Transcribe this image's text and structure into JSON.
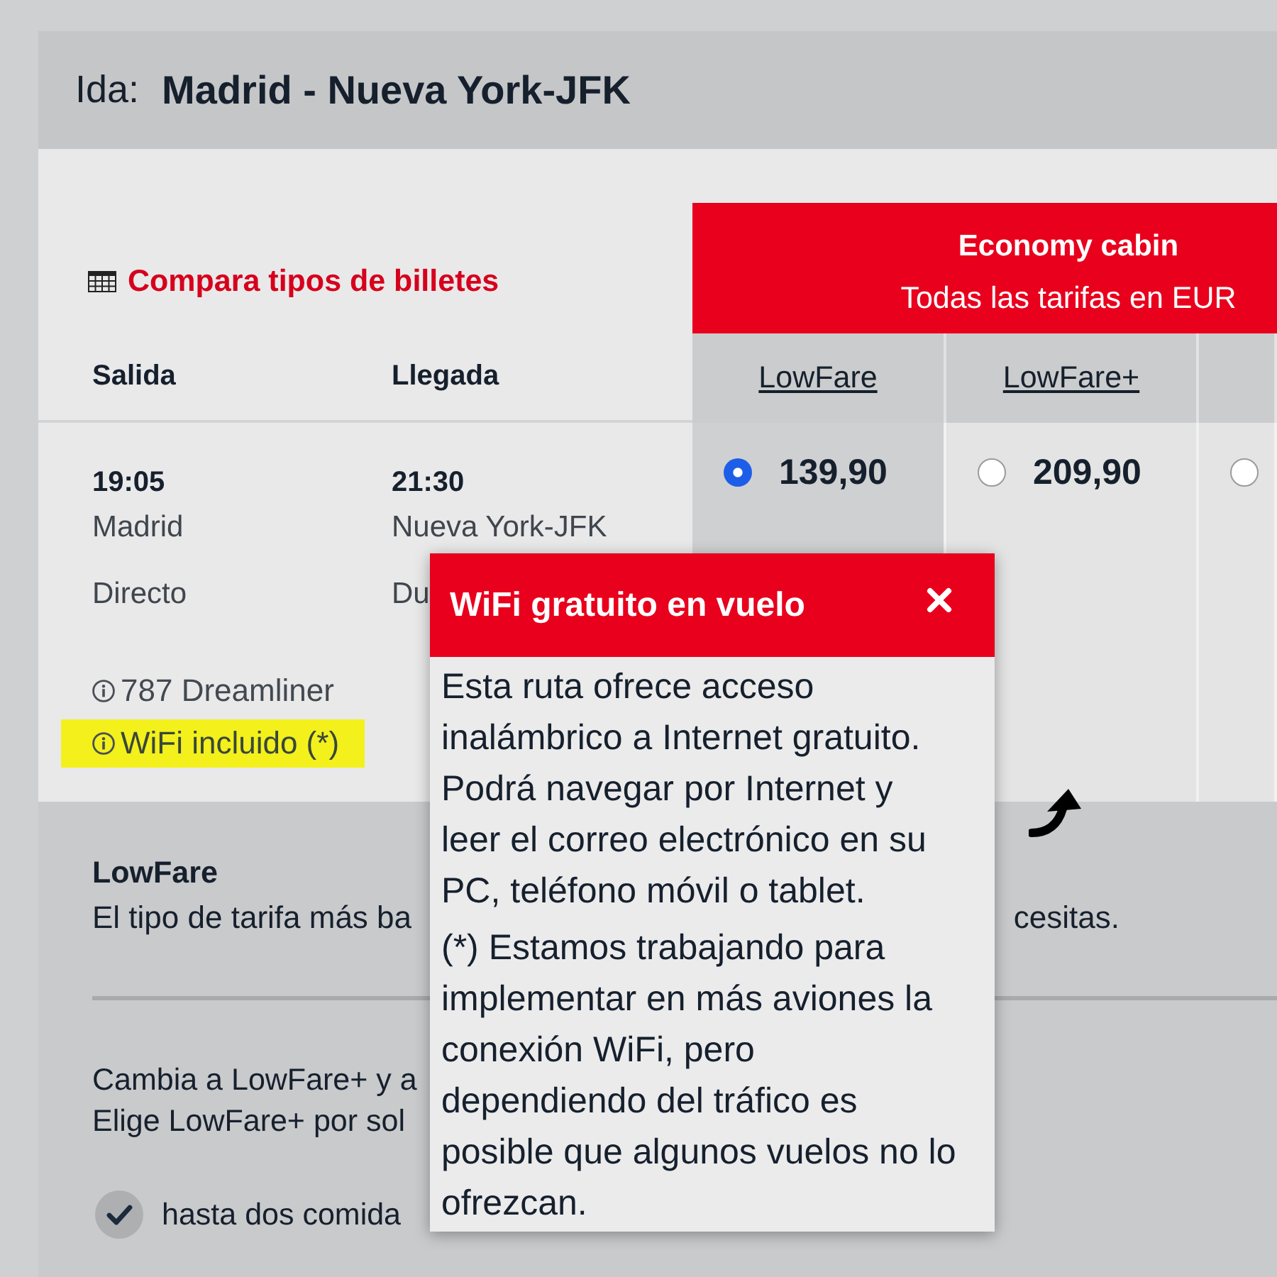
{
  "route": {
    "direction_label": "Ida:",
    "title": "Madrid - Nueva York-JFK"
  },
  "compare_link": "Compara tipos de billetes",
  "cabin": {
    "title": "Economy cabin",
    "subtitle": "Todas las tarifas en EUR"
  },
  "columns": {
    "departure": "Salida",
    "arrival": "Llegada"
  },
  "fares": [
    {
      "name": "LowFare",
      "price": "139,90",
      "selected": true
    },
    {
      "name": "LowFare+",
      "price": "209,90",
      "selected": false
    },
    {
      "selected": false
    }
  ],
  "flight": {
    "departure_time": "19:05",
    "departure_city": "Madrid",
    "stops": "Directo",
    "arrival_time": "21:30",
    "arrival_city": "Nueva York-JFK",
    "duration_partial": "Du",
    "amenities": [
      {
        "text": "787 Dreamliner",
        "highlighted": false
      },
      {
        "text": "WiFi incluido (*)",
        "highlighted": true
      }
    ]
  },
  "fare_description": {
    "title": "LowFare",
    "text_start": "El tipo de tarifa más ba",
    "text_end": "cesitas."
  },
  "upsell": {
    "lines": [
      "Cambia a LowFare+ y a",
      "Elige LowFare+ por sol"
    ],
    "features": [
      {
        "text": "hasta dos comida",
        "checked": true
      }
    ]
  },
  "popup": {
    "title": "WiFi gratuito en vuelo",
    "paragraphs": [
      [
        "Esta ruta ofrece acceso",
        "inalámbrico a Internet gratuito.",
        "Podrá navegar por Internet y",
        "leer el correo electrónico en su",
        "PC, teléfono móvil o tablet."
      ],
      [
        "(*) Estamos trabajando para",
        "implementar en más aviones la",
        "conexión WiFi, pero",
        "dependiendo del tráfico es",
        "posible que algunos vuelos no lo",
        "ofrezcan."
      ]
    ]
  }
}
